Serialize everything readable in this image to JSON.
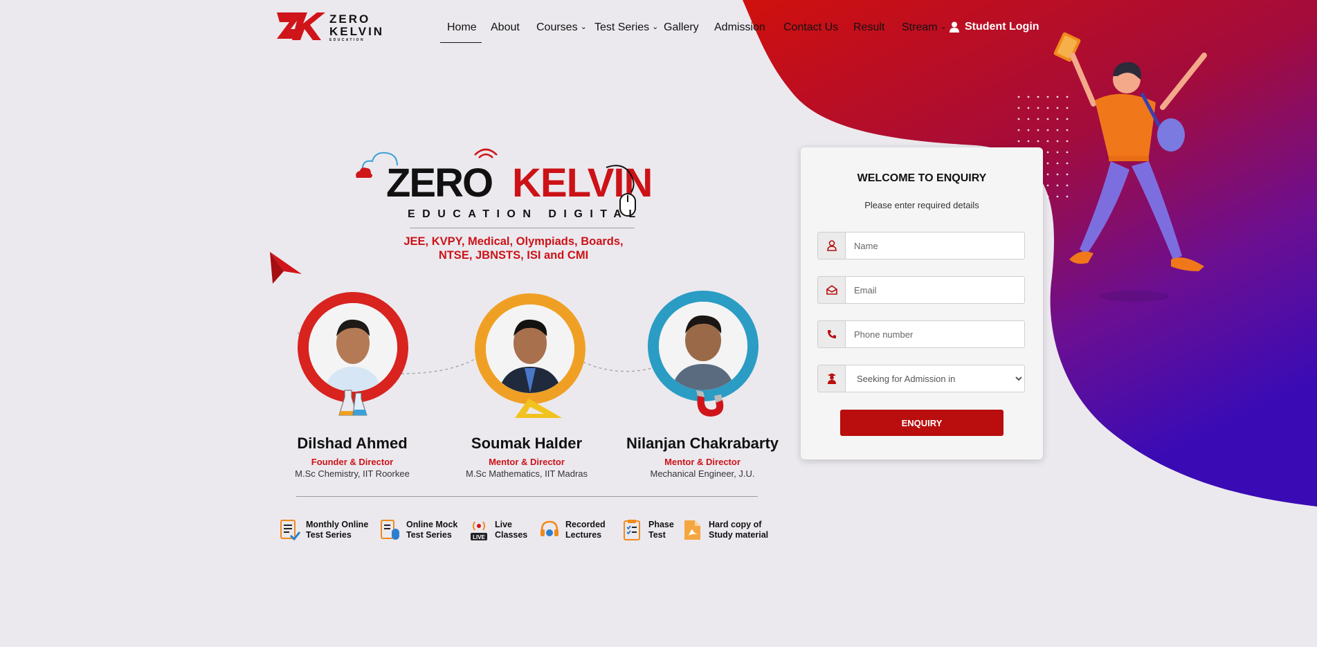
{
  "logo": {
    "line1": "ZERO",
    "line2": "KELVIN",
    "line3": "EDUCATION"
  },
  "nav": {
    "items": [
      {
        "label": "Home",
        "active": true,
        "dropdown": false
      },
      {
        "label": "About",
        "active": false,
        "dropdown": false
      },
      {
        "label": "Courses",
        "active": false,
        "dropdown": true
      },
      {
        "label": "Test Series",
        "active": false,
        "dropdown": true
      },
      {
        "label": "Gallery",
        "active": false,
        "dropdown": false
      },
      {
        "label": "Admission",
        "active": false,
        "dropdown": false
      },
      {
        "label": "Contact Us",
        "active": false,
        "dropdown": false
      },
      {
        "label": "Result",
        "active": false,
        "dropdown": false
      },
      {
        "label": "Stream",
        "active": false,
        "dropdown": true
      }
    ],
    "login_label": "Student Login",
    "login_icon": "user-icon"
  },
  "brand": {
    "zero": "ZERO",
    "kelvin": "KELVIN",
    "tagline": "EDUCATION DIGITAL",
    "subjects_line1": "JEE, KVPY, Medical, Olympiads, Boards,",
    "subjects_line2": "NTSE, JBNSTS, ISI and CMI"
  },
  "mentors": [
    {
      "name": "Dilshad Ahmed",
      "role": "Founder & Director",
      "qualification": "M.Sc Chemistry, IIT Roorkee",
      "ring_color": "#d8231f"
    },
    {
      "name": "Soumak Halder",
      "role": "Mentor & Director",
      "qualification": "M.Sc Mathematics, IIT Madras",
      "ring_color": "#efa024"
    },
    {
      "name": "Nilanjan Chakrabarty",
      "role": "Mentor & Director",
      "qualification": "Mechanical Engineer, J.U.",
      "ring_color": "#2b9cc4"
    }
  ],
  "features": [
    {
      "label": "Monthly Online\nTest Series",
      "icon": "document-check-icon"
    },
    {
      "label": "Online Mock\nTest Series",
      "icon": "mouse-document-icon"
    },
    {
      "label": "Live\nClasses",
      "icon": "live-broadcast-icon"
    },
    {
      "label": "Recorded\nLectures",
      "icon": "recorded-lecture-icon"
    },
    {
      "label": "Phase\nTest",
      "icon": "checklist-icon"
    },
    {
      "label": "Hard copy of\nStudy material",
      "icon": "pdf-file-icon"
    }
  ],
  "enquiry": {
    "title": "WELCOME TO ENQUIRY",
    "subtitle": "Please enter required details",
    "name_placeholder": "Name",
    "email_placeholder": "Email",
    "phone_placeholder": "Phone number",
    "admission_select": "Seeking for Admission in",
    "button_label": "ENQUIRY"
  },
  "colors": {
    "brand_red": "#cc1217",
    "button_red": "#b90d0e",
    "gradient_top": "#d0100d",
    "gradient_mid": "#8a0f6e",
    "gradient_bottom": "#3a0bb5",
    "background": "#ebe9ee"
  }
}
